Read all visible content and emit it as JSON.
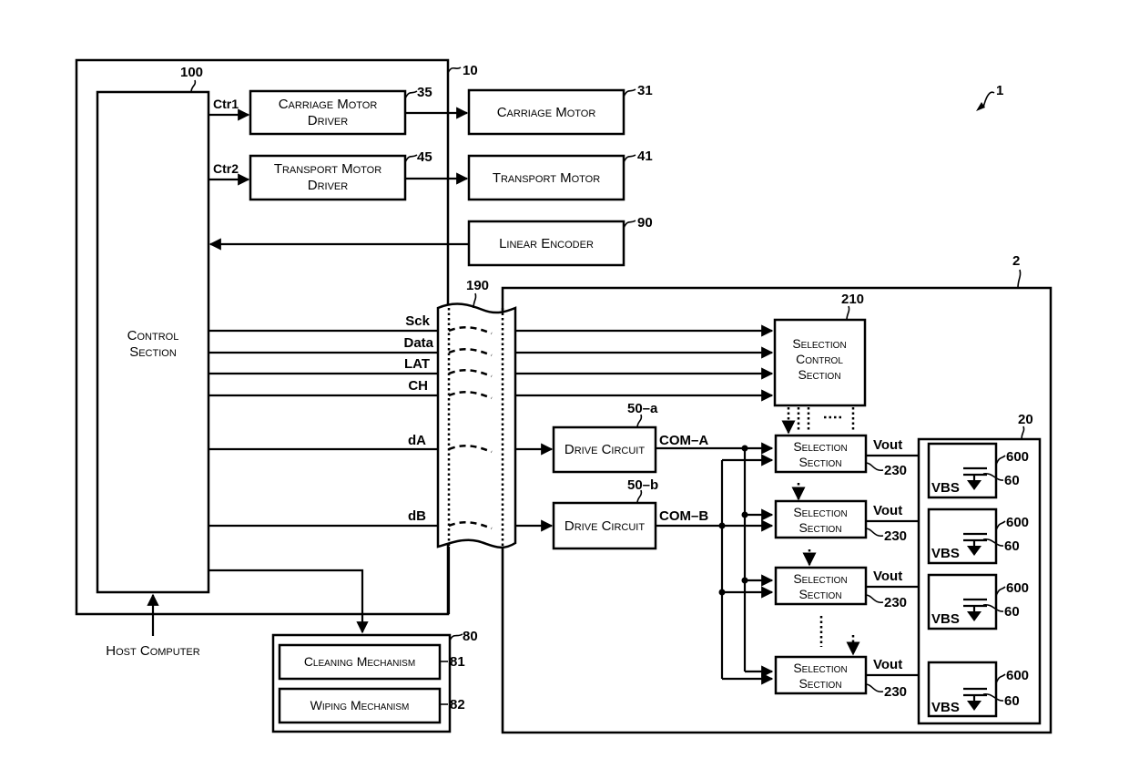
{
  "figure": {
    "ref_system": "1",
    "ref_printer": "10",
    "ref_head": "2"
  },
  "control_section": {
    "label_line1": "Control",
    "label_line2": "Section",
    "ref": "100"
  },
  "carriage_motor_driver": {
    "line1": "Carriage Motor",
    "line2": "Driver",
    "ref": "35",
    "signal": "Ctr1"
  },
  "transport_motor_driver": {
    "line1": "Transport Motor",
    "line2": "Driver",
    "ref": "45",
    "signal": "Ctr2"
  },
  "carriage_motor": {
    "label": "Carriage Motor",
    "ref": "31"
  },
  "transport_motor": {
    "label": "Transport Motor",
    "ref": "41"
  },
  "linear_encoder": {
    "label": "Linear Encoder",
    "ref": "90"
  },
  "cable": {
    "ref": "190"
  },
  "signals": [
    "Sck",
    "Data",
    "LAT",
    "CH",
    "dA",
    "dB"
  ],
  "selection_control": {
    "line1": "Selection",
    "line2": "Control",
    "line3": "Section",
    "ref": "210"
  },
  "drive_circuits": [
    {
      "label": "Drive Circuit",
      "ref": "50–a",
      "output": "COM–A"
    },
    {
      "label": "Drive Circuit",
      "ref": "50–b",
      "output": "COM–B"
    }
  ],
  "selection_sections": [
    {
      "line1": "Selection",
      "line2": "Section",
      "ref": "230",
      "output": "Vout"
    },
    {
      "line1": "Selection",
      "line2": "Section",
      "ref": "230",
      "output": "Vout"
    },
    {
      "line1": "Selection",
      "line2": "Section",
      "ref": "230",
      "output": "Vout"
    },
    {
      "line1": "Selection",
      "line2": "Section",
      "ref": "230",
      "output": "Vout"
    }
  ],
  "ejection_unit": {
    "ref": "20"
  },
  "ejection_sections": [
    {
      "ref": "600",
      "element_ref": "60",
      "label": "VBS"
    },
    {
      "ref": "600",
      "element_ref": "60",
      "label": "VBS"
    },
    {
      "ref": "600",
      "element_ref": "60",
      "label": "VBS"
    },
    {
      "ref": "600",
      "element_ref": "60",
      "label": "VBS"
    }
  ],
  "maintenance": {
    "ref": "80",
    "cleaning": {
      "label": "Cleaning Mechanism",
      "ref": "81"
    },
    "wiping": {
      "label": "Wiping Mechanism",
      "ref": "82"
    }
  },
  "host": {
    "label": "Host Computer"
  }
}
